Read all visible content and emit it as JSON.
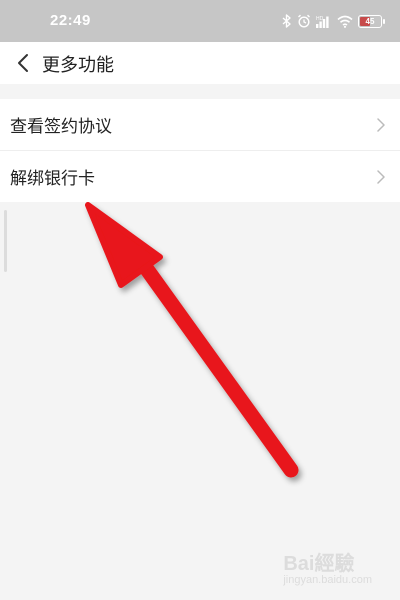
{
  "status_bar": {
    "time": "22:49",
    "battery_text": "45",
    "battery_level": 0.45,
    "icons": [
      "bluetooth-icon",
      "alarm-icon",
      "signal-icon",
      "wifi-icon",
      "battery-icon"
    ]
  },
  "header": {
    "title": "更多功能",
    "back_icon": "chevron-left-icon"
  },
  "menu": {
    "items": [
      {
        "label": "查看签约协议",
        "icon": "chevron-right-icon"
      },
      {
        "label": "解绑银行卡",
        "icon": "chevron-right-icon"
      }
    ]
  },
  "annotation": {
    "color": "#e8141a"
  },
  "watermark": {
    "text": "Bai經驗",
    "sub": "jingyan.baidu.com"
  },
  "colors": {
    "status_bar": "#c6c6c6",
    "background": "#f4f4f4",
    "surface": "#ffffff",
    "text": "#222222",
    "chevron": "#bbbbbb"
  }
}
